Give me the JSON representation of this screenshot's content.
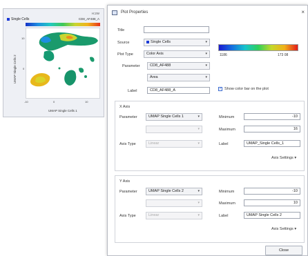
{
  "plot_window": {
    "zoom_label": "H:2W",
    "population_label": "Single Cells",
    "parameter_label": "CD8_AF488_A",
    "x_axis_label": "UMAP Single Cells 1",
    "y_axis_label": "UMAP Single Cells 2",
    "x_ticks": [
      "-10",
      "0",
      "10"
    ],
    "y_ticks": [
      "10",
      "0"
    ],
    "population_color": "#1d3bd6"
  },
  "dialog": {
    "title": "Plot Properties",
    "close_glyph": "×",
    "title_label": "Title",
    "title_value": "",
    "source_label": "Source",
    "source_value": "Single Cells",
    "plot_type_label": "Plot Type",
    "plot_type_value": "Color Axis",
    "parameter_label": "Parameter",
    "parameter_value": "CD8_AF488",
    "parameter_sub_value": "Area",
    "label_label": "Label",
    "label_value": "CD8_AF488_A",
    "colorbar_min": "1186",
    "colorbar_max": "173 08",
    "show_colorbar_label": "Show color bar on the plot",
    "show_colorbar_checked": "✓",
    "caret": "▾",
    "x_axis": {
      "group_title": "X Axis",
      "parameter_label": "Parameter",
      "parameter_value": "UMAP Single Cells 1",
      "axis_type_label": "Axis Type",
      "axis_type_value": "Linear",
      "minimum_label": "Minimum",
      "minimum_value": "-10",
      "maximum_label": "Maximum",
      "maximum_value": "16",
      "label_label": "Label",
      "label_value": "UMAP_Single Cells_1",
      "settings_label": "Axis Settings"
    },
    "y_axis": {
      "group_title": "Y Axis",
      "parameter_label": "Parameter",
      "parameter_value": "UMAP Single Cells 2",
      "axis_type_label": "Axis Type",
      "axis_type_value": "Linear",
      "minimum_label": "Minimum",
      "minimum_value": "-10",
      "maximum_label": "Maximum",
      "maximum_value": "10",
      "label_label": "Label",
      "label_value": "UMAP Single Cells 2",
      "settings_label": "Axis Settings"
    },
    "close_button_label": "Close"
  }
}
